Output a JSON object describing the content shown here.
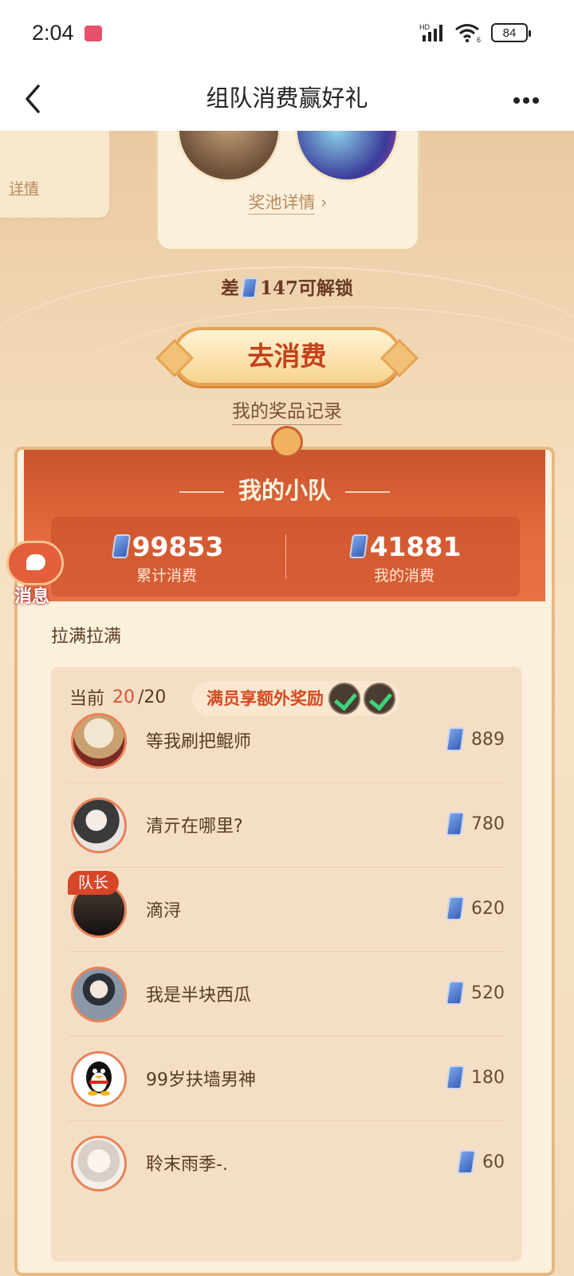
{
  "status_bar": {
    "time": "2:04",
    "network": "HD",
    "wifi_badge": "6",
    "battery": "84"
  },
  "titlebar": {
    "title": "组队消费赢好礼"
  },
  "hero": {
    "left_card_link": "详情",
    "pool_link": "奖池详情",
    "unlock_prefix": "差",
    "unlock_suffix": "147可解锁",
    "spend_button": "去消费",
    "record_link": "我的奖品记录"
  },
  "message_button": {
    "label": "消息"
  },
  "team": {
    "title": "我的小队",
    "total_value": "99853",
    "total_label": "累计消费",
    "mine_value": "41881",
    "mine_label": "我的消费",
    "team_name": "拉满拉满",
    "count_prefix": "当前",
    "count_current": "20",
    "count_total": "/20",
    "bonus_text": "满员享额外奖励",
    "captain_label": "队长",
    "members": [
      {
        "name": "等我刷把鲲师",
        "amount": "889",
        "avatar_color": "#c9a070"
      },
      {
        "name": "清亓在哪里?",
        "amount": "780",
        "avatar_color": "#5d5d5d"
      },
      {
        "name": "滴浔",
        "amount": "620",
        "avatar_color": "#2a2420"
      },
      {
        "name": "我是半块西瓜",
        "amount": "520",
        "avatar_color": "#7c8a9a"
      },
      {
        "name": "99岁扶墙男神",
        "amount": "180",
        "avatar_color": "#ffffff"
      },
      {
        "name": "聆末雨季-.",
        "amount": "60",
        "avatar_color": "#e9e2dc"
      }
    ]
  }
}
